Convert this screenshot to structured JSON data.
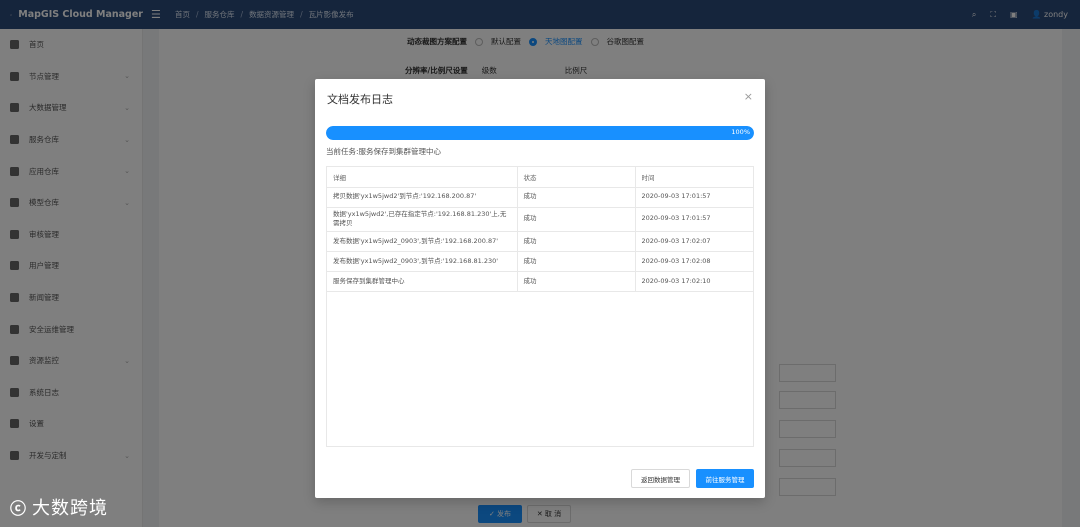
{
  "app": {
    "title": "MapGIS Cloud Manager",
    "user": "zondy"
  },
  "breadcrumb": [
    "首页",
    "服务仓库",
    "数据资源管理",
    "瓦片影像发布"
  ],
  "sidebar": {
    "items": [
      {
        "label": "首页",
        "icon": "home-icon",
        "has_arrow": false
      },
      {
        "label": "节点管理",
        "icon": "server-icon",
        "has_arrow": true
      },
      {
        "label": "大数据管理",
        "icon": "chart-icon",
        "has_arrow": true
      },
      {
        "label": "服务仓库",
        "icon": "box-icon",
        "has_arrow": true
      },
      {
        "label": "应用仓库",
        "icon": "grid-icon",
        "has_arrow": true
      },
      {
        "label": "模型仓库",
        "icon": "cube-icon",
        "has_arrow": true
      },
      {
        "label": "审核管理",
        "icon": "check-icon",
        "has_arrow": false
      },
      {
        "label": "用户管理",
        "icon": "user-icon",
        "has_arrow": false
      },
      {
        "label": "新闻管理",
        "icon": "news-icon",
        "has_arrow": false
      },
      {
        "label": "安全运维管理",
        "icon": "security-icon",
        "has_arrow": false
      },
      {
        "label": "资源监控",
        "icon": "monitor-icon",
        "has_arrow": true
      },
      {
        "label": "系统日志",
        "icon": "log-icon",
        "has_arrow": false
      },
      {
        "label": "设置",
        "icon": "gear-icon",
        "has_arrow": false
      },
      {
        "label": "开发与定制",
        "icon": "dev-icon",
        "has_arrow": true
      }
    ]
  },
  "form": {
    "dynamic_label": "动态裁图方案配置",
    "options": [
      "默认配置",
      "天地图配置",
      "谷歌图配置"
    ],
    "selected_option": "天地图配置",
    "resolution_label": "分辨率/比例尺设置",
    "resolution_col": "级数",
    "scale_col": "比例尺"
  },
  "bottom_buttons": {
    "publish": "✓ 发布",
    "cancel": "✕ 取 消"
  },
  "modal": {
    "title": "文档发布日志",
    "progress_percent": 100,
    "progress_label": "100%",
    "current_task": "当前任务:服务保存到集群管理中心",
    "columns": [
      "详细",
      "状态",
      "时间"
    ],
    "rows": [
      {
        "detail": "拷贝数据'yx1w5jwd2'到节点:'192.168.200.87'",
        "status": "成功",
        "time": "2020-09-03 17:01:57"
      },
      {
        "detail": "数据'yx1w5jwd2',已存在指定节点:'192.168.81.230'上,无需拷贝",
        "status": "成功",
        "time": "2020-09-03 17:01:57"
      },
      {
        "detail": "发布数据'yx1w5jwd2_0903',到节点:'192.168.200.87'",
        "status": "成功",
        "time": "2020-09-03 17:02:07"
      },
      {
        "detail": "发布数据'yx1w5jwd2_0903',到节点:'192.168.81.230'",
        "status": "成功",
        "time": "2020-09-03 17:02:08"
      },
      {
        "detail": "服务保存到集群管理中心",
        "status": "成功",
        "time": "2020-09-03 17:02:10"
      }
    ],
    "btn_back": "返回数据管理",
    "btn_go": "前往服务管理"
  },
  "watermark": {
    "symbol": "ⓒ",
    "text": "大数跨境"
  },
  "colors": {
    "topbar": "#2b4a78",
    "primary": "#1890ff"
  }
}
